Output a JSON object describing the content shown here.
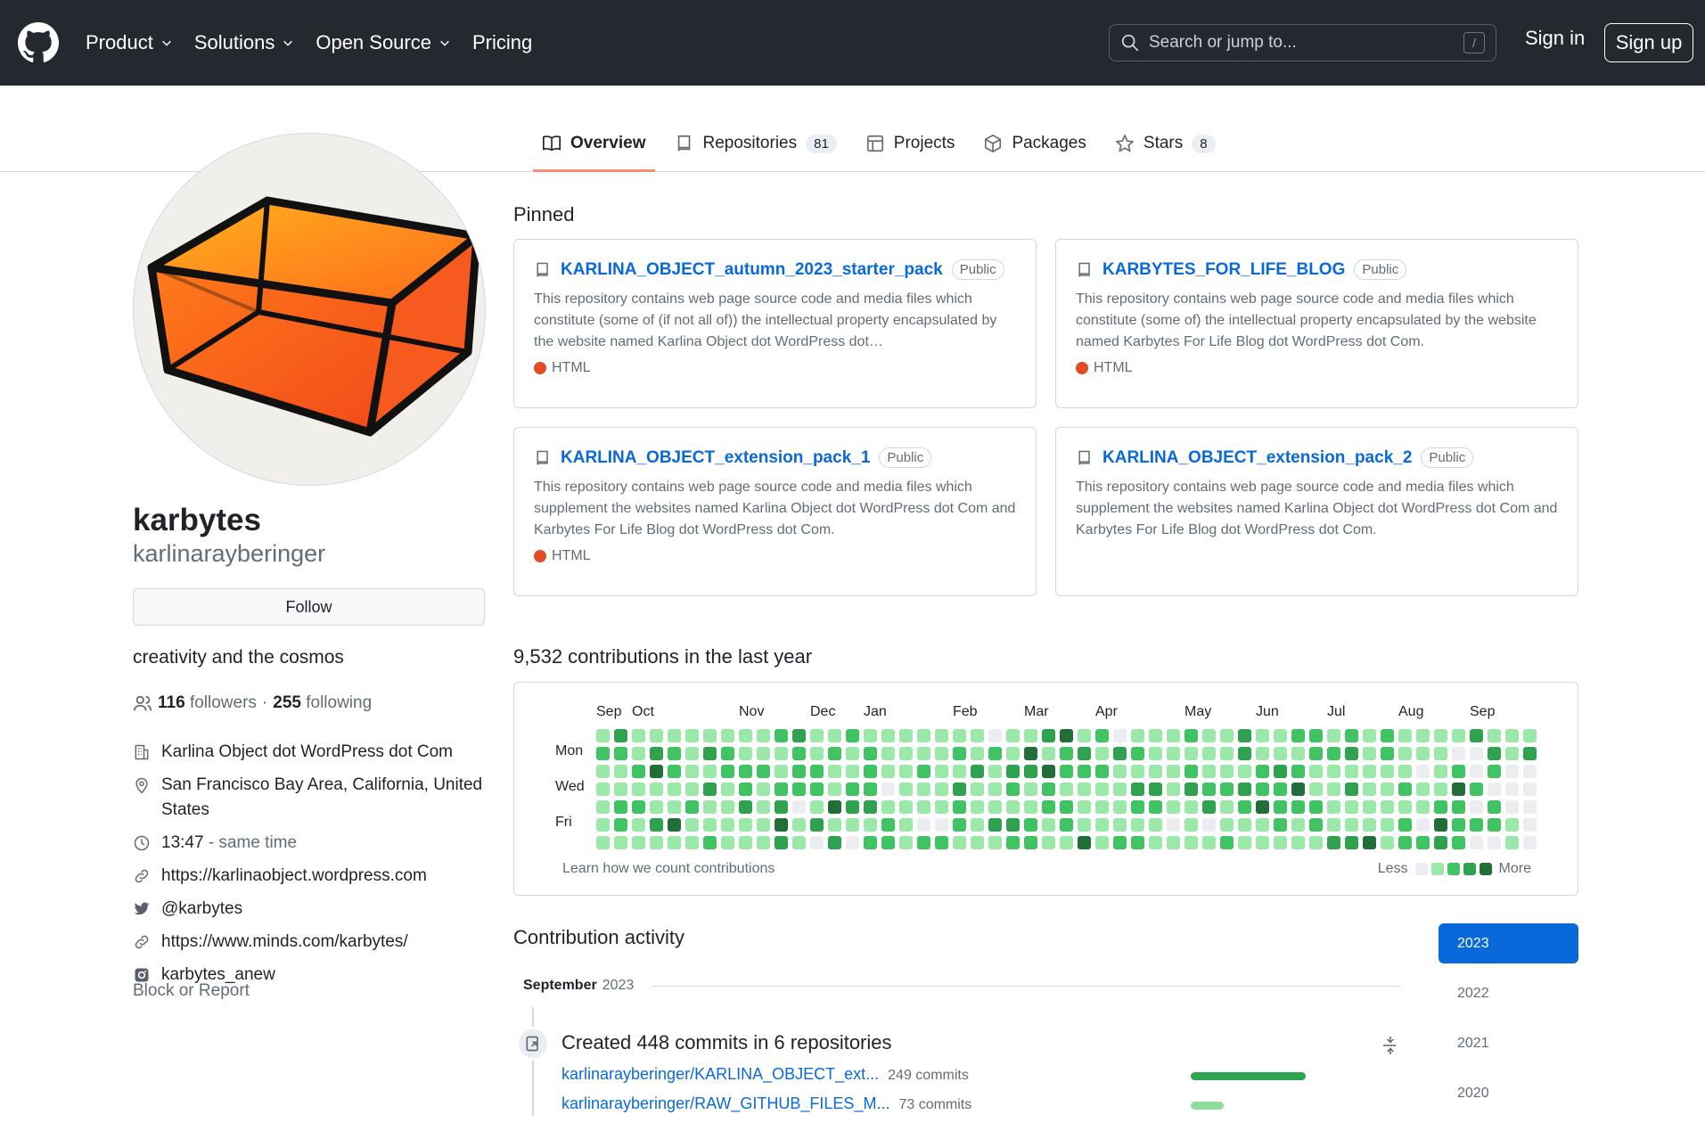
{
  "header": {
    "nav": [
      {
        "label": "Product",
        "dropdown": true
      },
      {
        "label": "Solutions",
        "dropdown": true
      },
      {
        "label": "Open Source",
        "dropdown": true
      },
      {
        "label": "Pricing",
        "dropdown": false
      }
    ],
    "search_placeholder": "Search or jump to...",
    "search_shortcut": "/",
    "sign_in": "Sign in",
    "sign_up": "Sign up"
  },
  "tabs": [
    {
      "label": "Overview",
      "icon": "book-icon",
      "active": true
    },
    {
      "label": "Repositories",
      "icon": "repo-icon",
      "count": "81"
    },
    {
      "label": "Projects",
      "icon": "table-icon"
    },
    {
      "label": "Packages",
      "icon": "package-icon"
    },
    {
      "label": "Stars",
      "icon": "star-icon",
      "count": "8"
    }
  ],
  "profile": {
    "name": "karbytes",
    "handle": "karlinarayberinger",
    "follow_label": "Follow",
    "bio": "creativity and the cosmos",
    "followers_count": "116",
    "followers_label": "followers",
    "separator": "·",
    "following_count": "255",
    "following_label": "following",
    "details": [
      {
        "icon": "organization-icon",
        "text": "Karlina Object dot WordPress dot Com"
      },
      {
        "icon": "location-icon",
        "text": "San Francisco Bay Area, California, United States"
      },
      {
        "icon": "clock-icon",
        "text": "13:47",
        "suffix": "- same time"
      },
      {
        "icon": "link-icon",
        "text": "https://karlinaobject.wordpress.com"
      },
      {
        "icon": "twitter-icon",
        "text": "@karbytes"
      },
      {
        "icon": "link-icon",
        "text": "https://www.minds.com/karbytes/"
      },
      {
        "icon": "instagram-icon",
        "text": "karbytes_anew"
      }
    ],
    "block_report": "Block or Report"
  },
  "pinned": {
    "title": "Pinned",
    "items": [
      {
        "name": "KARLINA_OBJECT_autumn_2023_starter_pack",
        "visibility": "Public",
        "description": "This repository contains web page source code and media files which constitute (some of (if not all of)) the intellectual property encapsulated by the website named Karlina Object dot WordPress dot…",
        "language": "HTML",
        "language_color": "#e34c26"
      },
      {
        "name": "KARBYTES_FOR_LIFE_BLOG",
        "visibility": "Public",
        "description": "This repository contains web page source code and media files which constitute (some of) the intellectual property encapsulated by the website named Karbytes For Life Blog dot WordPress dot Com.",
        "language": "HTML",
        "language_color": "#e34c26"
      },
      {
        "name": "KARLINA_OBJECT_extension_pack_1",
        "visibility": "Public",
        "description": "This repository contains web page source code and media files which supplement the websites named Karlina Object dot WordPress dot Com and Karbytes For Life Blog dot WordPress dot Com.",
        "language": "HTML",
        "language_color": "#e34c26"
      },
      {
        "name": "KARLINA_OBJECT_extension_pack_2",
        "visibility": "Public",
        "description": "This repository contains web page source code and media files which supplement the websites named Karlina Object dot WordPress dot Com and Karbytes For Life Blog dot WordPress dot Com.",
        "language": ""
      }
    ]
  },
  "contributions": {
    "title": "9,532 contributions in the last year",
    "months": [
      "Sep",
      "Oct",
      "Nov",
      "Dec",
      "Jan",
      "Feb",
      "Mar",
      "Apr",
      "May",
      "Jun",
      "Jul",
      "Aug",
      "Sep"
    ],
    "month_week_index": [
      0,
      2,
      8,
      12,
      15,
      20,
      24,
      28,
      33,
      37,
      41,
      45,
      49
    ],
    "day_labels": [
      "Mon",
      "Wed",
      "Fri"
    ],
    "weeks": 53,
    "learn_link": "Learn how we count contributions",
    "legend_less": "Less",
    "legend_more": "More",
    "colors": [
      "#ebedf0",
      "#9be9a8",
      "#40c463",
      "#30a14e",
      "#216e39"
    ]
  },
  "activity": {
    "title": "Contribution activity",
    "years": [
      "2023",
      "2022",
      "2021",
      "2020"
    ],
    "active_year": "2023",
    "month": "September",
    "month_year": "2023",
    "event_title": "Created 448 commits in 6 repositories",
    "repos": [
      {
        "name": "karlinarayberinger/KARLINA_OBJECT_ext...",
        "commits": "249 commits",
        "share": 0.56
      },
      {
        "name": "karlinarayberinger/RAW_GITHUB_FILES_M...",
        "commits": "73 commits",
        "share": 0.16
      }
    ]
  }
}
